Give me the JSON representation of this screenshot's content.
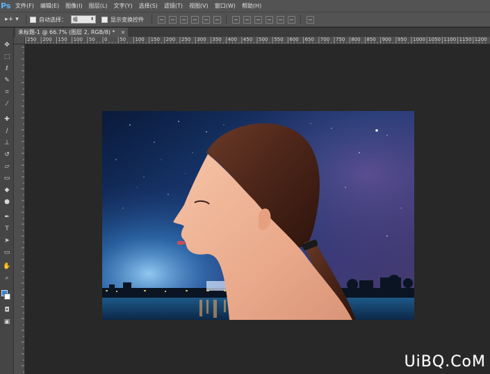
{
  "app": {
    "logo": "Ps"
  },
  "menu": [
    "文件(F)",
    "编辑(E)",
    "图像(I)",
    "图层(L)",
    "文字(Y)",
    "选择(S)",
    "滤镜(T)",
    "视图(V)",
    "窗口(W)",
    "帮助(H)"
  ],
  "options": {
    "tool_icon": "move-tool-icon",
    "auto_select_label": "自动选择：",
    "auto_select_value": "组",
    "show_transform_label": "显示变换控件"
  },
  "document_tab": {
    "title": "未标题-1 @ 66.7% (图层 2, RGB/8) *",
    "close": "×"
  },
  "ruler": {
    "h_labels": [
      "250",
      "200",
      "150",
      "100",
      "50",
      "0",
      "50",
      "100",
      "150",
      "200",
      "250",
      "300",
      "350",
      "400",
      "450",
      "500",
      "550",
      "600",
      "650",
      "700",
      "750",
      "800",
      "850",
      "900",
      "950",
      "1000",
      "1050",
      "1100",
      "1150",
      "1200"
    ]
  },
  "colors": {
    "foreground": "#2f86d4",
    "background": "#ffffff",
    "accent": "#5bb6ff"
  },
  "watermark": "UiBQ.CoM"
}
